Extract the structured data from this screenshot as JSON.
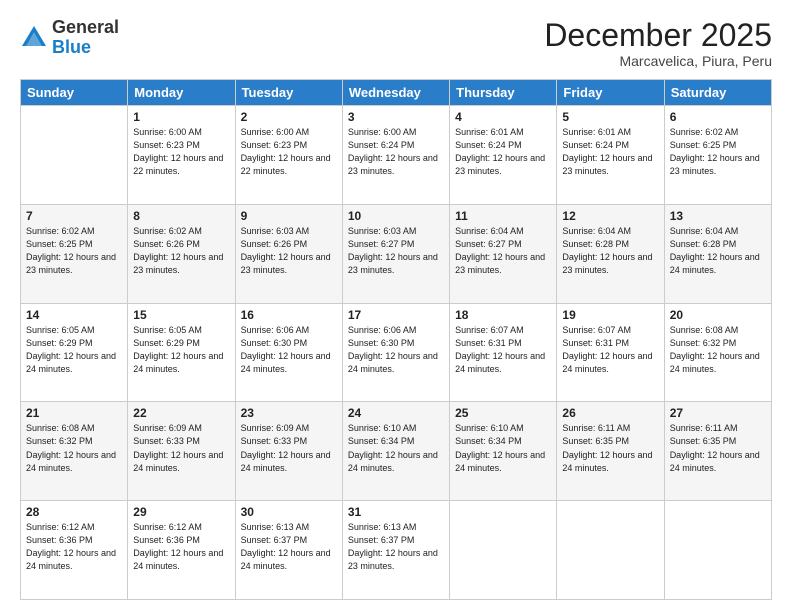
{
  "header": {
    "logo_general": "General",
    "logo_blue": "Blue",
    "month_title": "December 2025",
    "subtitle": "Marcavelica, Piura, Peru"
  },
  "weekdays": [
    "Sunday",
    "Monday",
    "Tuesday",
    "Wednesday",
    "Thursday",
    "Friday",
    "Saturday"
  ],
  "weeks": [
    [
      {
        "day": "",
        "sunrise": "",
        "sunset": "",
        "daylight": ""
      },
      {
        "day": "1",
        "sunrise": "Sunrise: 6:00 AM",
        "sunset": "Sunset: 6:23 PM",
        "daylight": "Daylight: 12 hours and 22 minutes."
      },
      {
        "day": "2",
        "sunrise": "Sunrise: 6:00 AM",
        "sunset": "Sunset: 6:23 PM",
        "daylight": "Daylight: 12 hours and 22 minutes."
      },
      {
        "day": "3",
        "sunrise": "Sunrise: 6:00 AM",
        "sunset": "Sunset: 6:24 PM",
        "daylight": "Daylight: 12 hours and 23 minutes."
      },
      {
        "day": "4",
        "sunrise": "Sunrise: 6:01 AM",
        "sunset": "Sunset: 6:24 PM",
        "daylight": "Daylight: 12 hours and 23 minutes."
      },
      {
        "day": "5",
        "sunrise": "Sunrise: 6:01 AM",
        "sunset": "Sunset: 6:24 PM",
        "daylight": "Daylight: 12 hours and 23 minutes."
      },
      {
        "day": "6",
        "sunrise": "Sunrise: 6:02 AM",
        "sunset": "Sunset: 6:25 PM",
        "daylight": "Daylight: 12 hours and 23 minutes."
      }
    ],
    [
      {
        "day": "7",
        "sunrise": "Sunrise: 6:02 AM",
        "sunset": "Sunset: 6:25 PM",
        "daylight": "Daylight: 12 hours and 23 minutes."
      },
      {
        "day": "8",
        "sunrise": "Sunrise: 6:02 AM",
        "sunset": "Sunset: 6:26 PM",
        "daylight": "Daylight: 12 hours and 23 minutes."
      },
      {
        "day": "9",
        "sunrise": "Sunrise: 6:03 AM",
        "sunset": "Sunset: 6:26 PM",
        "daylight": "Daylight: 12 hours and 23 minutes."
      },
      {
        "day": "10",
        "sunrise": "Sunrise: 6:03 AM",
        "sunset": "Sunset: 6:27 PM",
        "daylight": "Daylight: 12 hours and 23 minutes."
      },
      {
        "day": "11",
        "sunrise": "Sunrise: 6:04 AM",
        "sunset": "Sunset: 6:27 PM",
        "daylight": "Daylight: 12 hours and 23 minutes."
      },
      {
        "day": "12",
        "sunrise": "Sunrise: 6:04 AM",
        "sunset": "Sunset: 6:28 PM",
        "daylight": "Daylight: 12 hours and 23 minutes."
      },
      {
        "day": "13",
        "sunrise": "Sunrise: 6:04 AM",
        "sunset": "Sunset: 6:28 PM",
        "daylight": "Daylight: 12 hours and 24 minutes."
      }
    ],
    [
      {
        "day": "14",
        "sunrise": "Sunrise: 6:05 AM",
        "sunset": "Sunset: 6:29 PM",
        "daylight": "Daylight: 12 hours and 24 minutes."
      },
      {
        "day": "15",
        "sunrise": "Sunrise: 6:05 AM",
        "sunset": "Sunset: 6:29 PM",
        "daylight": "Daylight: 12 hours and 24 minutes."
      },
      {
        "day": "16",
        "sunrise": "Sunrise: 6:06 AM",
        "sunset": "Sunset: 6:30 PM",
        "daylight": "Daylight: 12 hours and 24 minutes."
      },
      {
        "day": "17",
        "sunrise": "Sunrise: 6:06 AM",
        "sunset": "Sunset: 6:30 PM",
        "daylight": "Daylight: 12 hours and 24 minutes."
      },
      {
        "day": "18",
        "sunrise": "Sunrise: 6:07 AM",
        "sunset": "Sunset: 6:31 PM",
        "daylight": "Daylight: 12 hours and 24 minutes."
      },
      {
        "day": "19",
        "sunrise": "Sunrise: 6:07 AM",
        "sunset": "Sunset: 6:31 PM",
        "daylight": "Daylight: 12 hours and 24 minutes."
      },
      {
        "day": "20",
        "sunrise": "Sunrise: 6:08 AM",
        "sunset": "Sunset: 6:32 PM",
        "daylight": "Daylight: 12 hours and 24 minutes."
      }
    ],
    [
      {
        "day": "21",
        "sunrise": "Sunrise: 6:08 AM",
        "sunset": "Sunset: 6:32 PM",
        "daylight": "Daylight: 12 hours and 24 minutes."
      },
      {
        "day": "22",
        "sunrise": "Sunrise: 6:09 AM",
        "sunset": "Sunset: 6:33 PM",
        "daylight": "Daylight: 12 hours and 24 minutes."
      },
      {
        "day": "23",
        "sunrise": "Sunrise: 6:09 AM",
        "sunset": "Sunset: 6:33 PM",
        "daylight": "Daylight: 12 hours and 24 minutes."
      },
      {
        "day": "24",
        "sunrise": "Sunrise: 6:10 AM",
        "sunset": "Sunset: 6:34 PM",
        "daylight": "Daylight: 12 hours and 24 minutes."
      },
      {
        "day": "25",
        "sunrise": "Sunrise: 6:10 AM",
        "sunset": "Sunset: 6:34 PM",
        "daylight": "Daylight: 12 hours and 24 minutes."
      },
      {
        "day": "26",
        "sunrise": "Sunrise: 6:11 AM",
        "sunset": "Sunset: 6:35 PM",
        "daylight": "Daylight: 12 hours and 24 minutes."
      },
      {
        "day": "27",
        "sunrise": "Sunrise: 6:11 AM",
        "sunset": "Sunset: 6:35 PM",
        "daylight": "Daylight: 12 hours and 24 minutes."
      }
    ],
    [
      {
        "day": "28",
        "sunrise": "Sunrise: 6:12 AM",
        "sunset": "Sunset: 6:36 PM",
        "daylight": "Daylight: 12 hours and 24 minutes."
      },
      {
        "day": "29",
        "sunrise": "Sunrise: 6:12 AM",
        "sunset": "Sunset: 6:36 PM",
        "daylight": "Daylight: 12 hours and 24 minutes."
      },
      {
        "day": "30",
        "sunrise": "Sunrise: 6:13 AM",
        "sunset": "Sunset: 6:37 PM",
        "daylight": "Daylight: 12 hours and 24 minutes."
      },
      {
        "day": "31",
        "sunrise": "Sunrise: 6:13 AM",
        "sunset": "Sunset: 6:37 PM",
        "daylight": "Daylight: 12 hours and 23 minutes."
      },
      {
        "day": "",
        "sunrise": "",
        "sunset": "",
        "daylight": ""
      },
      {
        "day": "",
        "sunrise": "",
        "sunset": "",
        "daylight": ""
      },
      {
        "day": "",
        "sunrise": "",
        "sunset": "",
        "daylight": ""
      }
    ]
  ]
}
